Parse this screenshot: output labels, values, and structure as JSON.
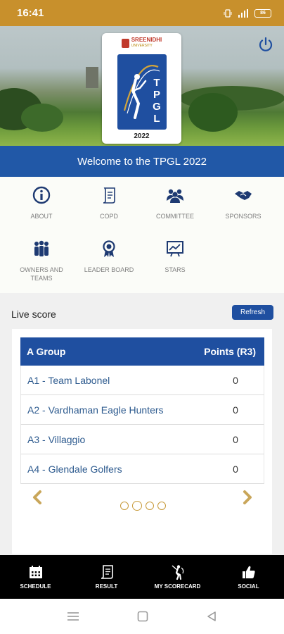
{
  "status_bar": {
    "time": "16:41",
    "battery_level": "86"
  },
  "hero": {
    "university_name": "SREENIDHI",
    "university_sub": "UNIVERSITY",
    "logo_text": "TPGL",
    "logo_year": "2022",
    "power_icon": "power-icon"
  },
  "welcome": {
    "text": "Welcome to the TPGL 2022"
  },
  "menu": {
    "items": [
      {
        "label": "ABOUT",
        "icon": "info-icon"
      },
      {
        "label": "COPD",
        "icon": "document-icon"
      },
      {
        "label": "COMMITTEE",
        "icon": "group-icon"
      },
      {
        "label": "SPONSORS",
        "icon": "handshake-icon"
      },
      {
        "label": "OWNERS AND TEAMS",
        "icon": "people-icon"
      },
      {
        "label": "LEADER BOARD",
        "icon": "medal-icon"
      },
      {
        "label": "STARS",
        "icon": "chart-board-icon"
      }
    ]
  },
  "live_score": {
    "label": "Live score",
    "refresh_label": "Refresh",
    "table": {
      "group_header": "A Group",
      "points_header": "Points (R3)",
      "rows": [
        {
          "team": "A1 - Team Labonel",
          "points": "0"
        },
        {
          "team": "A2 - Vardhaman Eagle Hunters",
          "points": "0"
        },
        {
          "team": "A3 - Villaggio",
          "points": "0"
        },
        {
          "team": "A4 - Glendale Golfers",
          "points": "0"
        }
      ]
    },
    "pagination": {
      "pages": 4,
      "current": 2
    },
    "accent_color": "#c79a3a"
  },
  "tabbar": {
    "tabs": [
      {
        "label": "SCHEDULE",
        "icon": "calendar-icon"
      },
      {
        "label": "RESULT",
        "icon": "scroll-icon"
      },
      {
        "label": "MY SCORECARD",
        "icon": "golfer-icon"
      },
      {
        "label": "SOCIAL",
        "icon": "thumbs-up-icon"
      }
    ]
  },
  "colors": {
    "brand_blue": "#1f4fa0",
    "status_gold": "#c8902c"
  }
}
